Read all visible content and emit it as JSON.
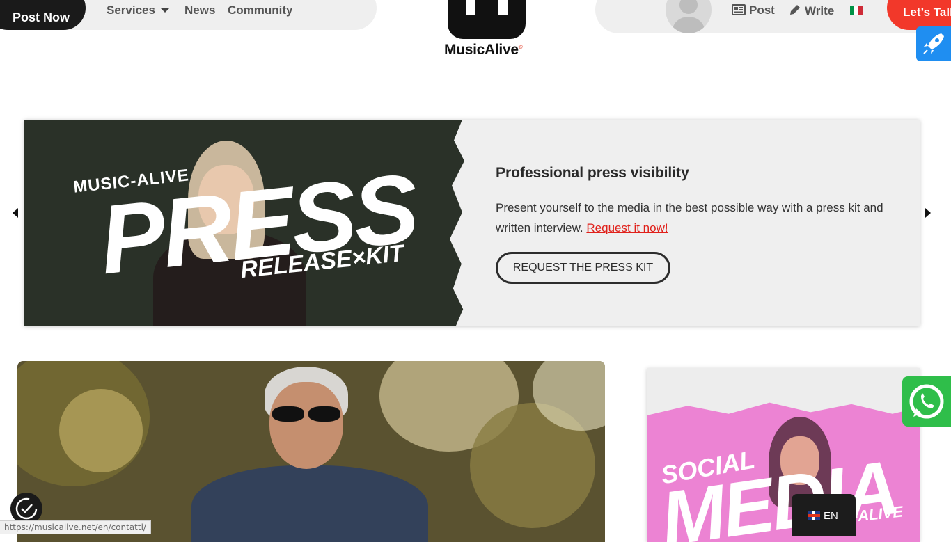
{
  "header": {
    "post_now": "Post Now",
    "nav": {
      "services": "Services",
      "news": "News",
      "community": "Community"
    },
    "logo_text": "MusicAlive",
    "logo_mark": "®",
    "post_label": "Post",
    "write_label": "Write",
    "lets_talk": "Let’s Talk",
    "flag_colors": [
      "#009246",
      "#ffffff",
      "#ce2b37"
    ]
  },
  "hero": {
    "art_top": "MUSIC-ALIVE",
    "art_main": "PRESS",
    "art_bottom": "RELEASE×KIT",
    "heading": "Professional press visibility",
    "text": "Present yourself to the media in the best possible way with a press kit and written interview.",
    "link": "Request it now!",
    "button": "REQUEST THE PRESS KIT"
  },
  "sidebar_promo": {
    "art_top": "SOCIAL",
    "art_main": "MEDIA",
    "art_side": "C-ALIVE"
  },
  "language": {
    "code": "EN"
  },
  "status_bar": {
    "url": "https://musicalive.net/en/contatti/"
  },
  "colors": {
    "accent_red": "#f2382a",
    "dark": "#1a1a1a",
    "whatsapp": "#2fbe4a",
    "rocket": "#1f8ef1",
    "promo_pink": "#ec83d3"
  },
  "icons": [
    "newspaper-icon",
    "pencil-icon",
    "rocket-icon",
    "whatsapp-icon",
    "accessibility-icon",
    "uk-flag-icon",
    "italy-flag-icon",
    "chevron-left-icon",
    "chevron-right-icon",
    "caret-down-icon"
  ]
}
